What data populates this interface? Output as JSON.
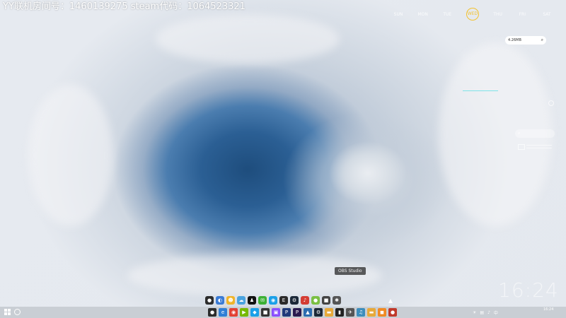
{
  "stream_banner": "YY联机房间号：1460139275  steam代码：1064523321",
  "weekdays": [
    {
      "label": "SUN",
      "active": false
    },
    {
      "label": "MON",
      "active": false
    },
    {
      "label": "TUE",
      "active": false
    },
    {
      "label": "WED",
      "active": true
    },
    {
      "label": "THU",
      "active": false
    },
    {
      "label": "FRI",
      "active": false
    },
    {
      "label": "SAT",
      "active": false
    }
  ],
  "mini_search": {
    "value": "4.26MB",
    "icon": "search-icon"
  },
  "side_search": {
    "icon": "search-icon"
  },
  "obs_tooltip": "OBS Studio",
  "desktop_clock": "16:24",
  "dock_icons": [
    {
      "name": "obs-icon",
      "glyph": "●",
      "color": "#2c2c2c"
    },
    {
      "name": "browser-icon",
      "glyph": "◐",
      "color": "#3a7bd5"
    },
    {
      "name": "face-app-icon",
      "glyph": "☻",
      "color": "#f0b429"
    },
    {
      "name": "cloud-app-icon",
      "glyph": "☁",
      "color": "#4aa3df"
    },
    {
      "name": "qq-penguin-icon",
      "glyph": "♟",
      "color": "#111111"
    },
    {
      "name": "wechat-icon",
      "glyph": "✉",
      "color": "#3cb034"
    },
    {
      "name": "chat-app-icon",
      "glyph": "◉",
      "color": "#1aa0e8"
    },
    {
      "name": "epic-games-icon",
      "glyph": "E",
      "color": "#2a2a2a"
    },
    {
      "name": "steam-icon",
      "glyph": "⚙",
      "color": "#1b2838"
    },
    {
      "name": "netease-music-icon",
      "glyph": "♪",
      "color": "#d43c33"
    },
    {
      "name": "green-app-icon",
      "glyph": "●",
      "color": "#7bc043"
    },
    {
      "name": "game-app-icon",
      "glyph": "■",
      "color": "#444444"
    },
    {
      "name": "settings-app-icon",
      "glyph": "✱",
      "color": "#555555"
    }
  ],
  "taskbar_apps": [
    {
      "name": "obs-taskbar-icon",
      "glyph": "●",
      "color": "#2c2c2c"
    },
    {
      "name": "edge-taskbar-icon",
      "glyph": "e",
      "color": "#2f7fd6"
    },
    {
      "name": "chrome-taskbar-icon",
      "glyph": "◉",
      "color": "#e34133"
    },
    {
      "name": "nvidia-taskbar-icon",
      "glyph": "▶",
      "color": "#76b900"
    },
    {
      "name": "chat-taskbar-icon",
      "glyph": "◆",
      "color": "#1aa0e8"
    },
    {
      "name": "game-taskbar-icon",
      "glyph": "■",
      "color": "#333333"
    },
    {
      "name": "video-taskbar-icon",
      "glyph": "▣",
      "color": "#8a4fff"
    },
    {
      "name": "ps-taskbar-icon",
      "glyph": "P",
      "color": "#1f3a7a"
    },
    {
      "name": "premiere-taskbar-icon",
      "glyph": "P",
      "color": "#2a1a4f"
    },
    {
      "name": "photo-taskbar-icon",
      "glyph": "▲",
      "color": "#2b6cb0"
    },
    {
      "name": "steam-taskbar-icon",
      "glyph": "⚙",
      "color": "#1b2838"
    },
    {
      "name": "folder-taskbar-icon",
      "glyph": "▬",
      "color": "#e7a93a"
    },
    {
      "name": "terminal-taskbar-icon",
      "glyph": "▮",
      "color": "#222222"
    },
    {
      "name": "plane-taskbar-icon",
      "glyph": "✈",
      "color": "#555555"
    },
    {
      "name": "music-taskbar-icon",
      "glyph": "♫",
      "color": "#3c8dbc"
    },
    {
      "name": "explorer-taskbar-icon",
      "glyph": "▬",
      "color": "#e7a93a"
    },
    {
      "name": "orange-taskbar-icon",
      "glyph": "◼",
      "color": "#f08a24"
    },
    {
      "name": "recorder-taskbar-icon",
      "glyph": "●",
      "color": "#c0392b"
    }
  ],
  "tray_icons": [
    "weather-icon",
    "network-icon",
    "volume-icon",
    "language-icon"
  ],
  "tray_time": "16:24"
}
